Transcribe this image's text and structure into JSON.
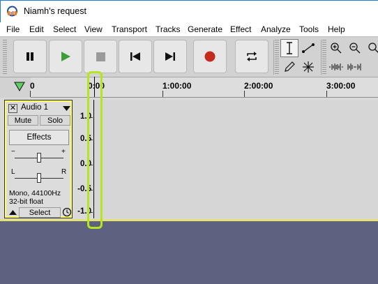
{
  "window": {
    "title": "Niamh's request"
  },
  "menu": [
    "File",
    "Edit",
    "Select",
    "View",
    "Transport",
    "Tracks",
    "Generate",
    "Effect",
    "Analyze",
    "Tools",
    "Help"
  ],
  "timeline": {
    "ticks": [
      "0",
      "0:00",
      "1:00:00",
      "2:00:00",
      "3:00:00"
    ]
  },
  "track": {
    "name": "Audio 1",
    "close_glyph": "✕",
    "mute": "Mute",
    "solo": "Solo",
    "effects": "Effects",
    "gain_minus": "−",
    "gain_plus": "+",
    "pan_left": "L",
    "pan_right": "R",
    "info_line1": "Mono, 44100Hz",
    "info_line2": "32-bit float",
    "select": "Select"
  },
  "vruler": [
    "1.0",
    "0.5",
    "0.0",
    "-0.5",
    "-1.0"
  ],
  "colors": {
    "accent_record": "#c42b1c",
    "play_green": "#3b9e3b",
    "selection_highlight": "#b5e61d",
    "track_focus": "#ffff66",
    "empty_bg": "#5f6180"
  }
}
